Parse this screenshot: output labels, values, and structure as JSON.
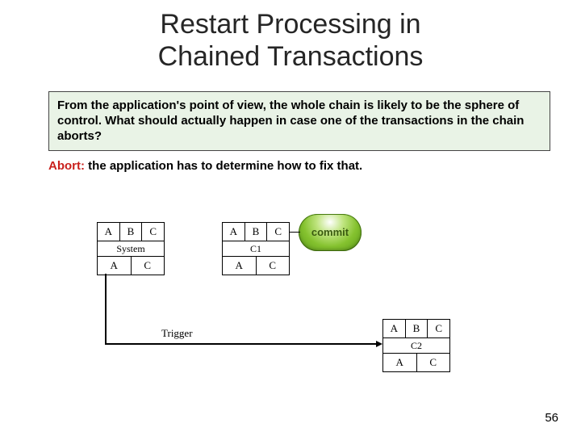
{
  "title_line1": "Restart Processing in",
  "title_line2": "Chained Transactions",
  "green_text": "From the application's point of view, the whole chain is likely to be the sphere of control. What should actually happen in case one of the transactions in the chain aborts?",
  "abort_label": "Abort:",
  "abort_rest": " the application has to determine how to fix that.",
  "commit_label": "commit",
  "trigger_label": "Trigger",
  "page_number": "56",
  "block_left": {
    "top": [
      "A",
      "B",
      "C"
    ],
    "mid": "System",
    "bot": [
      "A",
      "C"
    ]
  },
  "block_mid": {
    "top": [
      "A",
      "B",
      "C"
    ],
    "mid": "C1",
    "bot": [
      "A",
      "C"
    ]
  },
  "block_right": {
    "top": [
      "A",
      "B",
      "C"
    ],
    "mid": "C2",
    "bot": [
      "A",
      "C"
    ]
  }
}
